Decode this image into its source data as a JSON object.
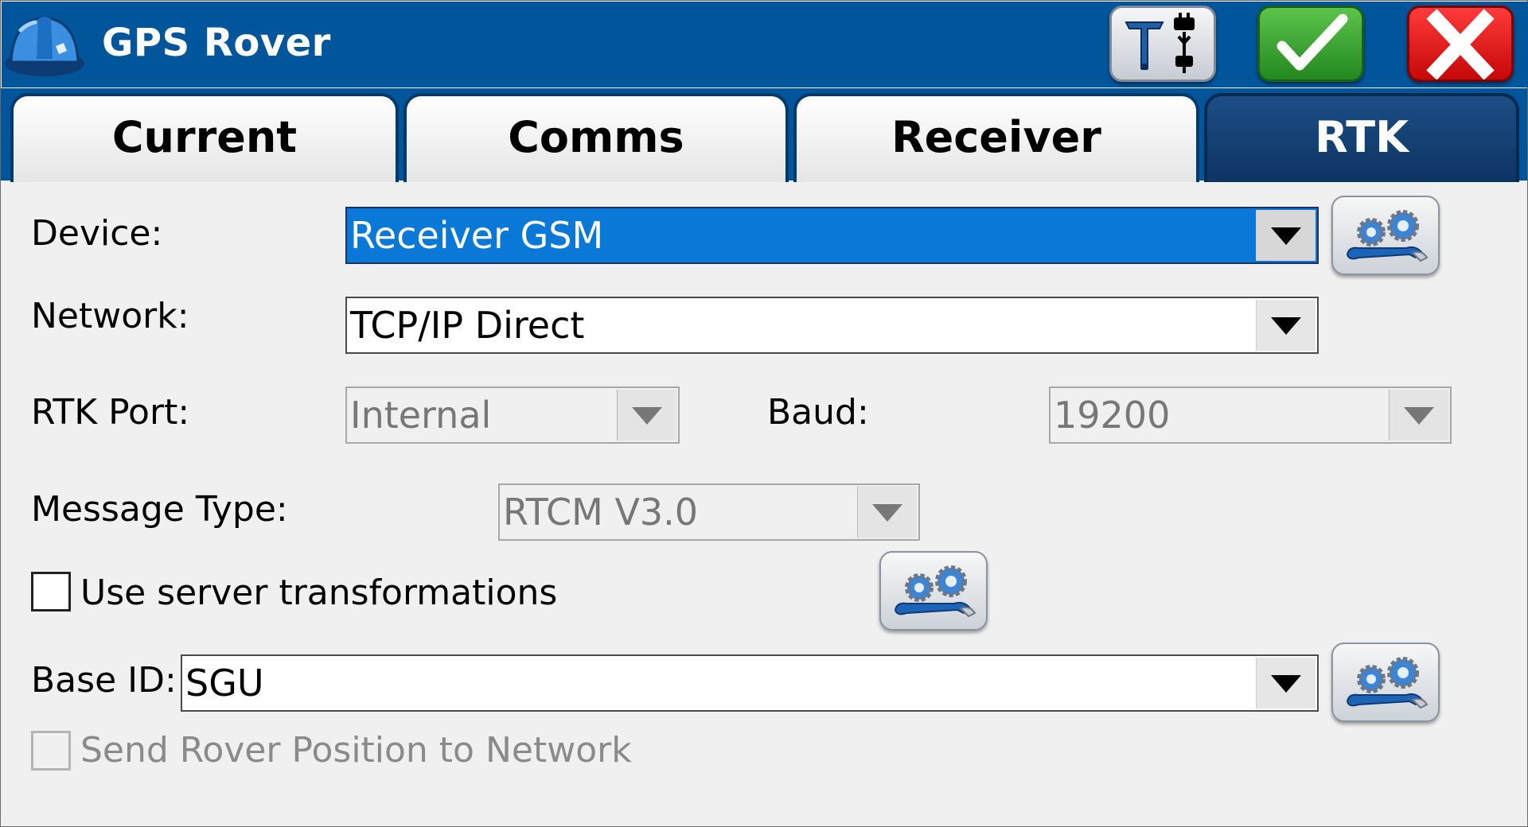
{
  "window": {
    "title": "GPS Rover",
    "logo_icon": "hardhat-icon",
    "buttons": {
      "antenna_icon": "rover-antenna-icon",
      "ok_icon": "checkmark-icon",
      "cancel_icon": "close-x-icon"
    }
  },
  "tabs": [
    {
      "label": "Current",
      "active": false
    },
    {
      "label": "Comms",
      "active": false
    },
    {
      "label": "Receiver",
      "active": false
    },
    {
      "label": "RTK",
      "active": true
    }
  ],
  "form": {
    "device": {
      "label": "Device:",
      "value": "Receiver GSM",
      "selected": true
    },
    "network": {
      "label": "Network:",
      "value": "TCP/IP Direct"
    },
    "rtk_port": {
      "label": "RTK Port:",
      "value": "Internal",
      "enabled": false
    },
    "baud": {
      "label": "Baud:",
      "value": "19200",
      "enabled": false
    },
    "message_type": {
      "label": "Message Type:",
      "value": "RTCM V3.0",
      "enabled": false
    },
    "use_server_transformations": {
      "label": "Use server transformations",
      "checked": false
    },
    "base_id": {
      "label": "Base ID:",
      "value": "SGU"
    },
    "send_rover_position": {
      "label": "Send Rover Position to Network",
      "checked": false,
      "enabled": false
    },
    "settings_icon": "gears-wrench-icon"
  },
  "colors": {
    "titlebar": "#00559b",
    "active_tab": "#0d3462",
    "selection": "#0a78d6",
    "ok_green": "#2e9a28",
    "cancel_red": "#d80c0c"
  }
}
